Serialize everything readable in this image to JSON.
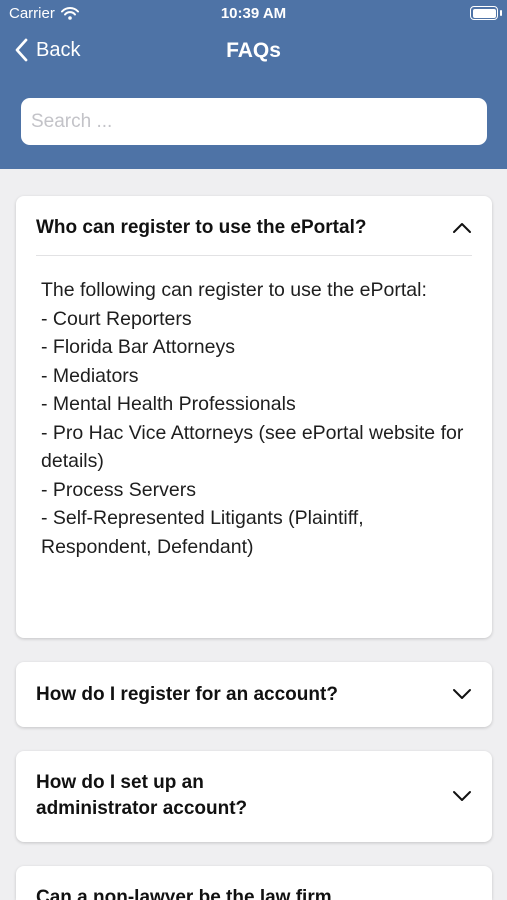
{
  "status_bar": {
    "carrier": "Carrier",
    "time": "10:39 AM"
  },
  "nav": {
    "back_label": "Back",
    "title": "FAQs"
  },
  "search": {
    "placeholder": "Search ..."
  },
  "faqs": [
    {
      "question": "Who can register to use the ePortal?",
      "expanded": true,
      "answer": "The following can register to use the ePortal:\n- Court Reporters\n- Florida Bar Attorneys\n- Mediators\n- Mental Health Professionals\n- Pro Hac Vice Attorneys (see ePortal website for details)\n- Process Servers\n- Self-Represented Litigants (Plaintiff, Respondent, Defendant)"
    },
    {
      "question": "How do I register for an account?",
      "expanded": false
    },
    {
      "question": "How do I set up an administrator account?",
      "expanded": false
    },
    {
      "question": "Can a non-lawyer be the law firm",
      "expanded": false
    }
  ],
  "colors": {
    "header": "#4e73a6",
    "background": "#efeff1",
    "card": "#ffffff"
  },
  "icons": [
    "wifi-icon",
    "battery-icon",
    "chevron-left-icon",
    "chevron-up-icon",
    "chevron-down-icon"
  ]
}
